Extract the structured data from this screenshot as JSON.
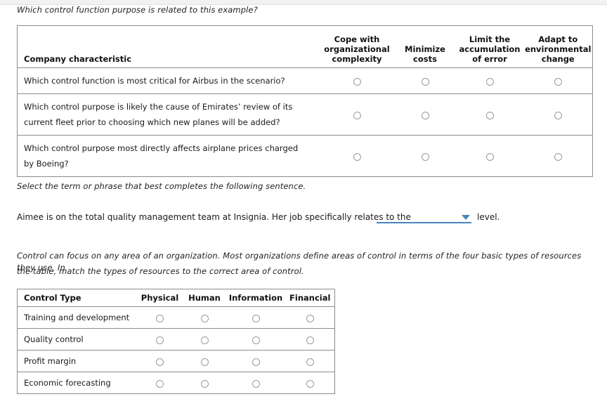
{
  "question1": {
    "prompt": "Which control function purpose is related to this example?",
    "table": {
      "columns": [
        "Company characteristic",
        "Cope with organizational complexity",
        "Minimize costs",
        "Limit the accumulation of error",
        "Adapt to environmental change"
      ],
      "column_lines": [
        [
          "Company characteristic"
        ],
        [
          "Cope with",
          "organizational",
          "complexity"
        ],
        [
          "Minimize",
          "costs"
        ],
        [
          "Limit the",
          "accumulation",
          "of error"
        ],
        [
          "Adapt to",
          "environmental",
          "change"
        ]
      ],
      "rows": [
        {
          "label": "Which control function is most critical for Airbus in the scenario?",
          "label_lines": [
            "Which control function is most critical for Airbus in the scenario?"
          ],
          "selected": null
        },
        {
          "label": "Which control purpose is likely the cause of Emirates’ review of its current fleet prior to choosing which new planes will be added?",
          "label_lines": [
            "Which control purpose is likely the cause of Emirates’ review of its",
            "current fleet prior to choosing which new planes will be added?"
          ],
          "selected": null
        },
        {
          "label": "Which control purpose most directly affects airplane prices charged by Boeing?",
          "label_lines": [
            "Which control purpose most directly affects airplane prices charged",
            "by Boeing?"
          ],
          "selected": null
        }
      ]
    }
  },
  "question2": {
    "prompt": "Select the term or phrase that best completes the following sentence.",
    "sentence_before": "Aimee is on the total quality management team at Insignia. Her job specifically relates to the",
    "sentence_after": "level.",
    "dropdown": {
      "value": "",
      "placeholder": "",
      "accent_color": "#4a84b8"
    }
  },
  "question3": {
    "prompt_lines": [
      "Control can focus on any area of an organization. Most organizations define areas of control in terms of the four basic types of resources they use. In",
      "the table, match the types of resources to the correct area of control."
    ],
    "table": {
      "columns": [
        "Control Type",
        "Physical",
        "Human",
        "Information",
        "Financial"
      ],
      "rows": [
        {
          "label": "Training and development",
          "selected": null
        },
        {
          "label": "Quality control",
          "selected": null
        },
        {
          "label": "Profit margin",
          "selected": null
        },
        {
          "label": "Economic forecasting",
          "selected": null
        }
      ]
    }
  },
  "theme": {
    "border_color": "#8c8c8c",
    "text_color": "#1a1a1a",
    "radio_border": "#9a9a9a",
    "top_strip": "#f2f2f2"
  }
}
